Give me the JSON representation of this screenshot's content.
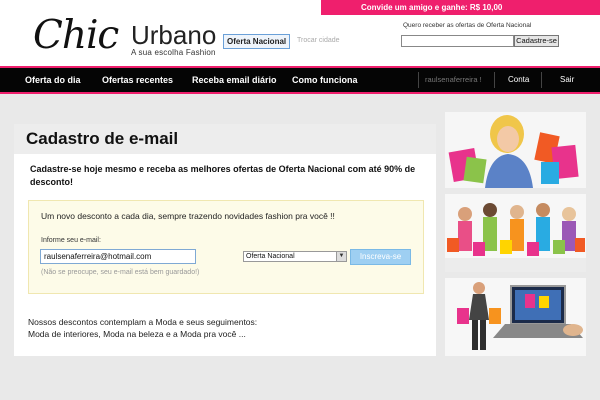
{
  "header": {
    "invite_prefix": "Convide um amigo e ganhe: ",
    "invite_amount": "R$ 10,00",
    "logo_chic": "Chic",
    "logo_urbano": "Urbano",
    "logo_tagline": "A sua escolha Fashion",
    "city": "Oferta Nacional",
    "change_city": "Trocar cidade",
    "subscribe_label": "Quero receber as ofertas de Oferta Nacional",
    "subscribe_button": "Cadastre-se"
  },
  "nav": {
    "items": [
      "Oferta do dia",
      "Ofertas recentes",
      "Receba email diário",
      "Como funciona"
    ],
    "user": "raulsenaferreira !",
    "account": "Conta",
    "logout": "Sair"
  },
  "main": {
    "title": "Cadastro de e-mail",
    "lead": "Cadastre-se hoje mesmo e receba as melhores ofertas de Oferta Nacional com até 90% de desconto!",
    "form_intro": "Um novo desconto a cada dia, sempre trazendo novidades fashion pra você !!",
    "email_label": "Informe seu e-mail:",
    "email_value": "raulsenaferreira@hotmail.com",
    "email_note": "(Não se preocupe, seu e-mail está bem guardado!)",
    "city_option": "Oferta Nacional",
    "submit_label": "Inscreva-se",
    "footer_line1": "Nossos descontos contemplam a Moda e seus seguimentos:",
    "footer_line2": "Moda de interiores, Moda na beleza e a Moda pra você ..."
  },
  "colors": {
    "accent": "#ef1f6d",
    "nav_bg": "#050505",
    "button_blue": "#9ecff2"
  }
}
